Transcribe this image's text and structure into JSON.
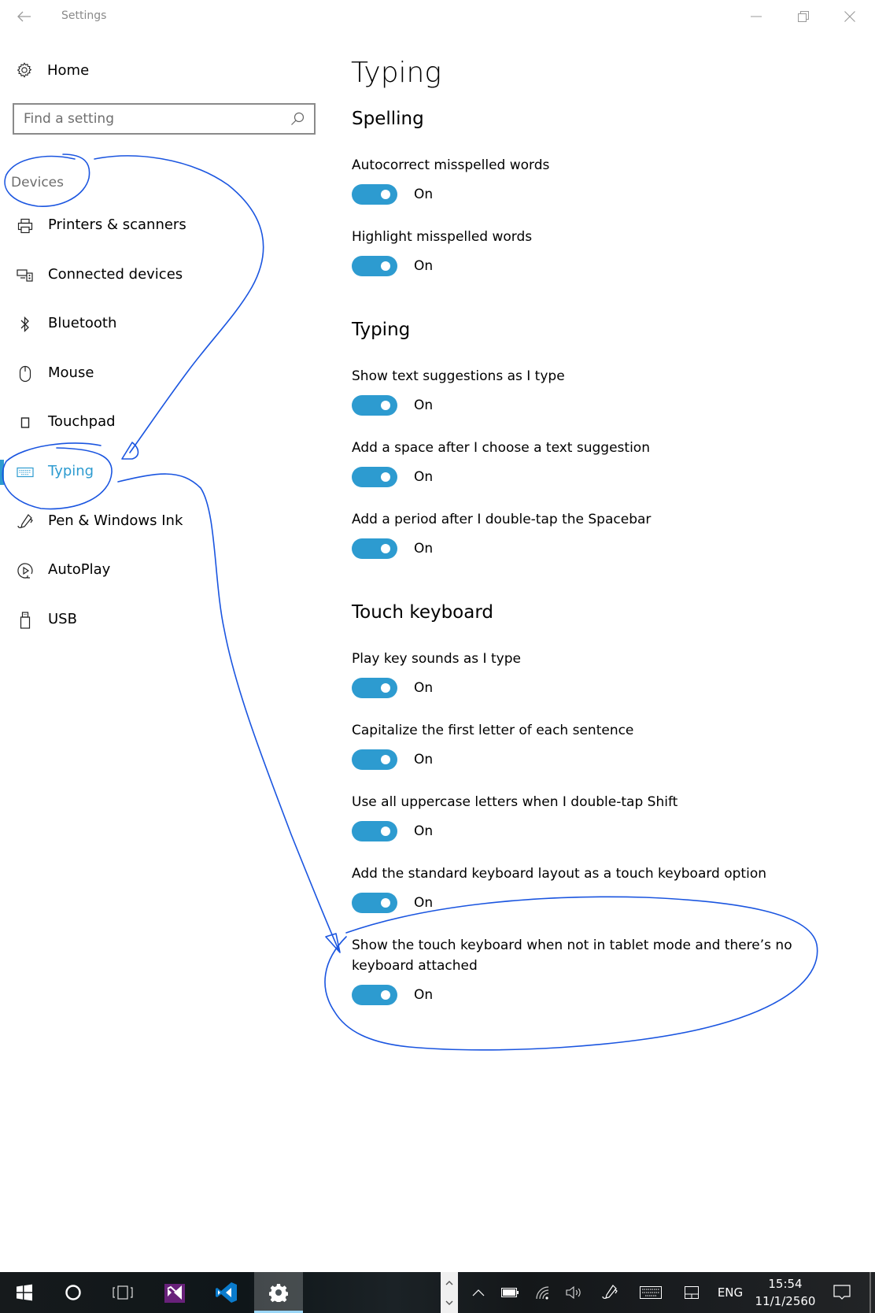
{
  "window": {
    "title": "Settings",
    "back_icon": "arrow-left-icon",
    "controls": {
      "minimize": "minimize-icon",
      "maximize": "restore-icon",
      "close": "close-icon"
    }
  },
  "sidebar": {
    "home": {
      "label": "Home",
      "icon": "gear-icon"
    },
    "search": {
      "placeholder": "Find a setting",
      "value": "",
      "icon": "search-icon"
    },
    "group_label": "Devices",
    "items": [
      {
        "label": "Printers & scanners",
        "icon": "printer-icon",
        "selected": false
      },
      {
        "label": "Connected devices",
        "icon": "connected-devices-icon",
        "selected": false
      },
      {
        "label": "Bluetooth",
        "icon": "bluetooth-icon",
        "selected": false
      },
      {
        "label": "Mouse",
        "icon": "mouse-icon",
        "selected": false
      },
      {
        "label": "Touchpad",
        "icon": "touchpad-icon",
        "selected": false
      },
      {
        "label": "Typing",
        "icon": "keyboard-icon",
        "selected": true
      },
      {
        "label": "Pen & Windows Ink",
        "icon": "pen-icon",
        "selected": false
      },
      {
        "label": "AutoPlay",
        "icon": "autoplay-icon",
        "selected": false
      },
      {
        "label": "USB",
        "icon": "usb-icon",
        "selected": false
      }
    ]
  },
  "main": {
    "title": "Typing",
    "sections": [
      {
        "title": "Spelling",
        "settings": [
          {
            "label": "Autocorrect misspelled words",
            "state": "On",
            "on": true
          },
          {
            "label": "Highlight misspelled words",
            "state": "On",
            "on": true
          }
        ]
      },
      {
        "title": "Typing",
        "settings": [
          {
            "label": "Show text suggestions as I type",
            "state": "On",
            "on": true
          },
          {
            "label": "Add a space after I choose a text suggestion",
            "state": "On",
            "on": true
          },
          {
            "label": "Add a period after I double-tap the Spacebar",
            "state": "On",
            "on": true
          }
        ]
      },
      {
        "title": "Touch keyboard",
        "settings": [
          {
            "label": "Play key sounds as I type",
            "state": "On",
            "on": true
          },
          {
            "label": "Capitalize the first letter of each sentence",
            "state": "On",
            "on": true
          },
          {
            "label": "Use all uppercase letters when I double-tap Shift",
            "state": "On",
            "on": true
          },
          {
            "label": "Add the standard keyboard layout as a touch keyboard option",
            "state": "On",
            "on": true
          },
          {
            "label": "Show the touch keyboard when not in tablet mode and there’s no keyboard attached",
            "state": "On",
            "on": true
          }
        ]
      }
    ]
  },
  "annotations": {
    "ink_color": "#1a55e0",
    "marks": [
      "circle-around-devices",
      "arrow-to-typing",
      "circle-around-typing",
      "arrow-to-last-setting",
      "circle-around-last-setting"
    ]
  },
  "taskbar": {
    "apps": [
      {
        "name": "start",
        "icon": "windows-logo-icon"
      },
      {
        "name": "cortana",
        "icon": "cortana-circle-icon"
      },
      {
        "name": "task-view",
        "icon": "task-view-icon"
      },
      {
        "name": "visual-studio",
        "icon": "visual-studio-icon"
      },
      {
        "name": "vs-code",
        "icon": "vscode-icon"
      },
      {
        "name": "settings",
        "icon": "gear-icon",
        "active": true
      }
    ],
    "tray": {
      "language": "ENG",
      "time": "15:54",
      "date": "11/1/2560",
      "icons": [
        "chevron-up-icon",
        "battery-icon",
        "wifi-icon",
        "volume-icon",
        "pen-workspace-icon",
        "touch-keyboard-icon",
        "touchpad-icon",
        "action-center-icon"
      ]
    },
    "colors": {
      "accent": "#2d9bd0",
      "active_underline": "#9ad6f7"
    }
  }
}
